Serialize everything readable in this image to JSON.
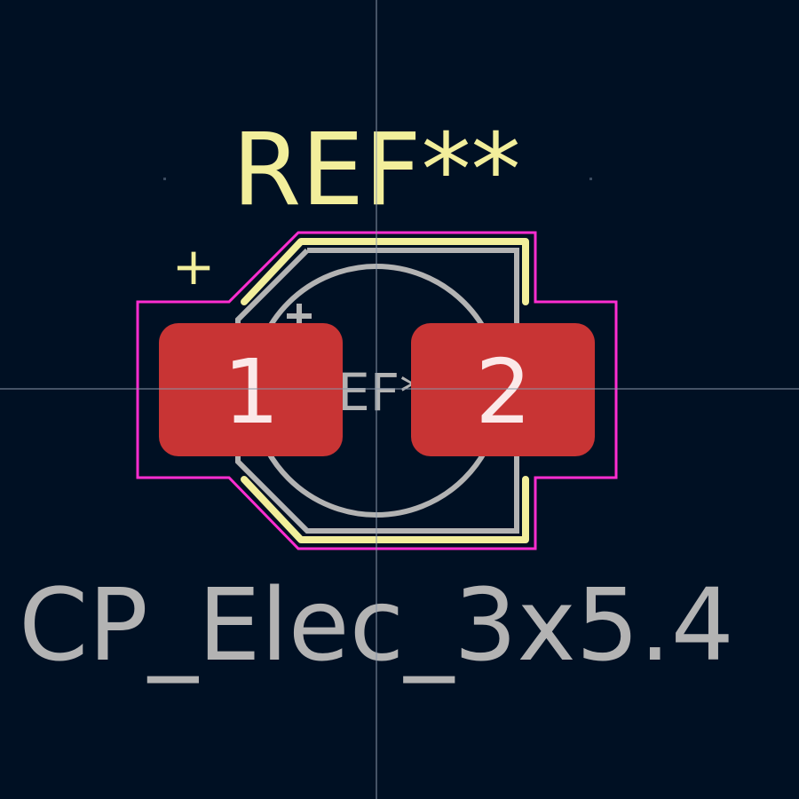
{
  "reference": "REF**",
  "fab_reference": "REF**",
  "value": "CP_Elec_3x5.4",
  "polarity_mark": "+",
  "pads": [
    {
      "number": "1"
    },
    {
      "number": "2"
    }
  ],
  "colors": {
    "background": "#001023",
    "silkscreen": "#f2ee9b",
    "fabrication": "#b3b3b3",
    "courtyard": "#ff2dd0",
    "pad": "#c83434",
    "crosshair": "#8a96a8"
  },
  "icons": {
    "polarity": "plus-icon",
    "origin": "crosshair-icon"
  }
}
